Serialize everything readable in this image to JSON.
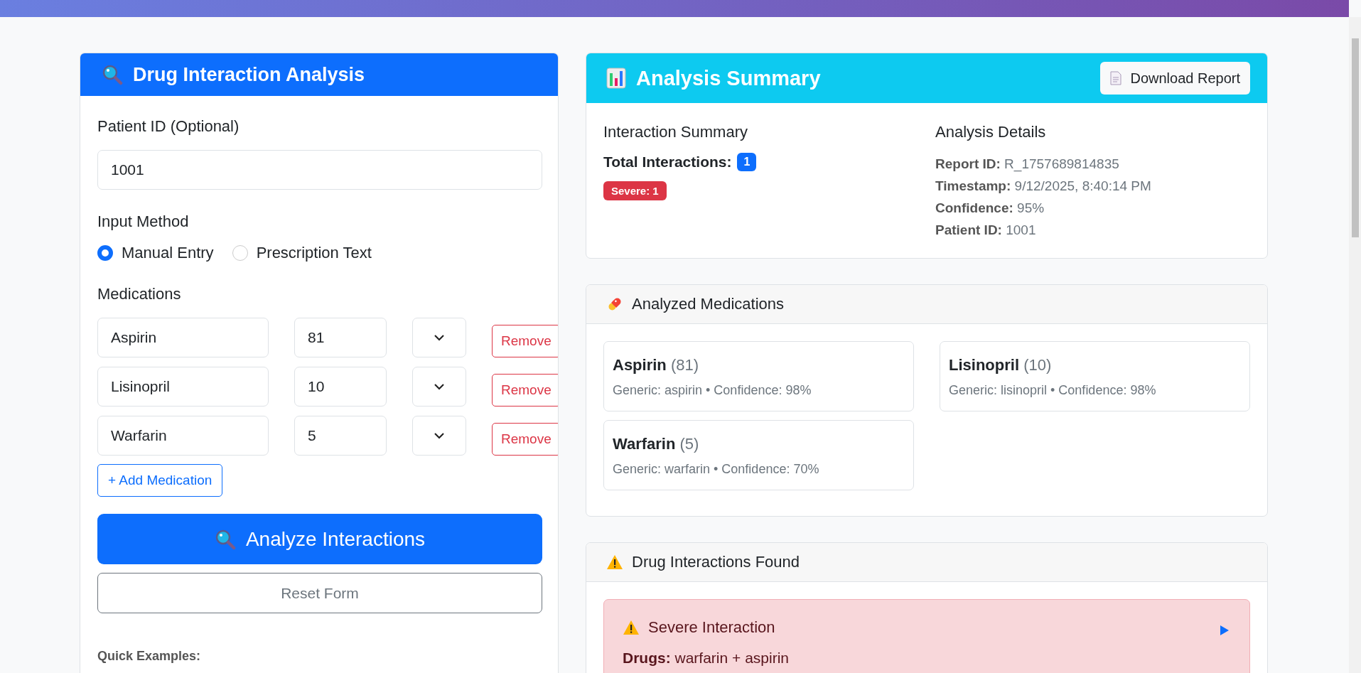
{
  "left_panel": {
    "title": "Drug Interaction Analysis",
    "patient_id": {
      "label": "Patient ID (Optional)",
      "value": "1001"
    },
    "input_method": {
      "label": "Input Method",
      "options": [
        {
          "label": "Manual Entry",
          "selected": true
        },
        {
          "label": "Prescription Text",
          "selected": false
        }
      ]
    },
    "medications": {
      "label": "Medications",
      "rows": [
        {
          "name": "Aspirin",
          "dose": "81",
          "remove": "Remove"
        },
        {
          "name": "Lisinopril",
          "dose": "10",
          "remove": "Remove"
        },
        {
          "name": "Warfarin",
          "dose": "5",
          "remove": "Remove"
        }
      ],
      "add_button": "+ Add Medication"
    },
    "analyze_button": "Analyze Interactions",
    "reset_button": "Reset Form",
    "quick_examples_label": "Quick Examples:"
  },
  "summary": {
    "title": "Analysis Summary",
    "download_button": "Download Report",
    "interaction_summary": {
      "heading": "Interaction Summary",
      "total_label": "Total Interactions:",
      "total": "1",
      "badges": [
        {
          "text": "Severe: 1",
          "color": "#dc3545"
        }
      ]
    },
    "details": {
      "heading": "Analysis Details",
      "items": [
        {
          "label": "Report ID:",
          "value": "R_1757689814835"
        },
        {
          "label": "Timestamp:",
          "value": "9/12/2025, 8:40:14 PM"
        },
        {
          "label": "Confidence:",
          "value": "95%"
        },
        {
          "label": "Patient ID:",
          "value": "1001"
        }
      ]
    }
  },
  "medications_card": {
    "title": "Analyzed Medications",
    "items": [
      {
        "name": "Aspirin",
        "dose": "(81)",
        "info": "Generic: aspirin • Confidence: 98%"
      },
      {
        "name": "Lisinopril",
        "dose": "(10)",
        "info": "Generic: lisinopril • Confidence: 98%"
      },
      {
        "name": "Warfarin",
        "dose": "(5)",
        "info": "Generic: warfarin • Confidence: 70%"
      }
    ]
  },
  "interactions_card": {
    "title": "Drug Interactions Found",
    "items": [
      {
        "severity": "Severe Interaction",
        "drugs_label": "Drugs:",
        "drugs": "warfarin + aspirin",
        "expanded": false
      }
    ]
  }
}
